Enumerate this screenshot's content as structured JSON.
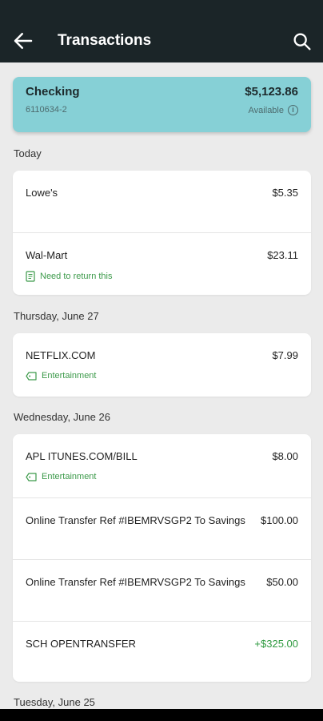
{
  "header": {
    "title": "Transactions",
    "back_icon": "arrow-left-icon",
    "search_icon": "search-icon"
  },
  "account": {
    "name": "Checking",
    "number": "6110634-2",
    "balance": "$5,123.86",
    "available_label": "Available",
    "color": "#86d0d6"
  },
  "sections": [
    {
      "date": "Today",
      "transactions": [
        {
          "name": "Lowe's",
          "amount": "$5.35"
        },
        {
          "name": "Wal-Mart",
          "amount": "$23.11",
          "tag": "Need to return this",
          "tag_icon": "note-icon"
        }
      ]
    },
    {
      "date": "Thursday, June 27",
      "transactions": [
        {
          "name": "NETFLIX.COM",
          "amount": "$7.99",
          "tag": "Entertainment",
          "tag_icon": "tag-icon"
        }
      ]
    },
    {
      "date": "Wednesday, June 26",
      "transactions": [
        {
          "name": "APL ITUNES.COM/BILL",
          "amount": "$8.00",
          "tag": "Entertainment",
          "tag_icon": "tag-icon"
        },
        {
          "name": "Online Transfer Ref #IBEMRVSGP2 To Savings",
          "amount": "$100.00"
        },
        {
          "name": "Online Transfer Ref #IBEMRVSGP2 To Savings",
          "amount": "$50.00"
        },
        {
          "name": "SCH OPENTRANSFER",
          "amount": "+$325.00",
          "credit": true
        }
      ]
    },
    {
      "date": "Tuesday, June 25",
      "transactions": []
    }
  ],
  "colors": {
    "appbar": "#1b2528",
    "credit": "#2e9a3f",
    "tag": "#3c9a4a"
  }
}
